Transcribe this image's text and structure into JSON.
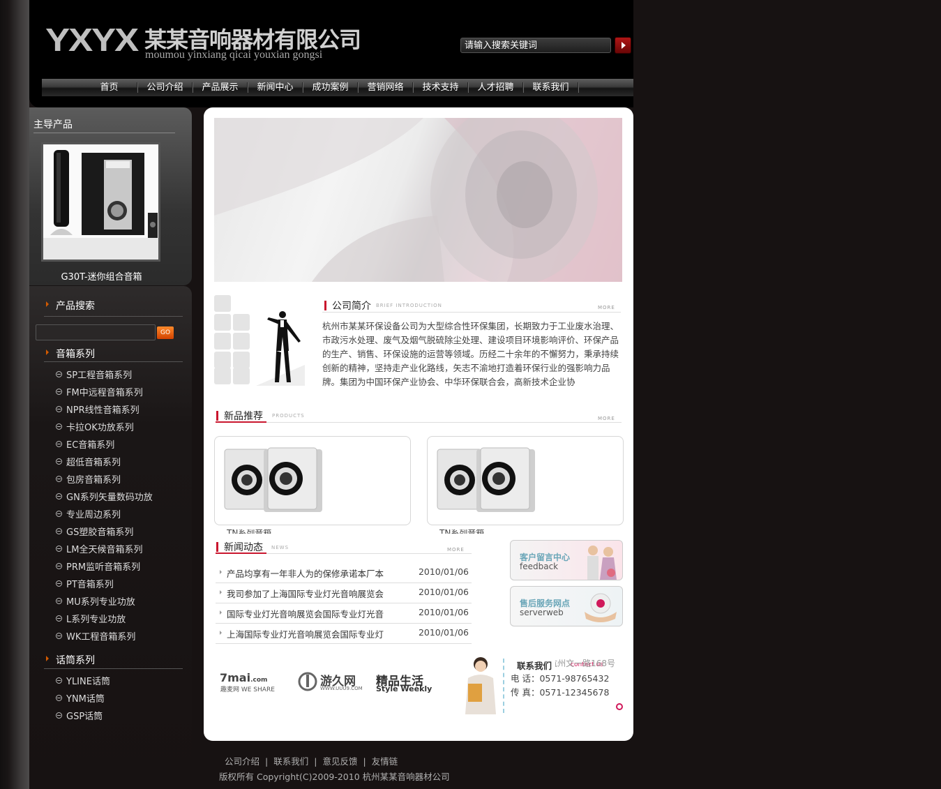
{
  "header": {
    "logo_en": "YXYX",
    "logo_cn": "某某音响器材有限公司",
    "logo_pinyin": "moumou yinxiang qicai youxian gongsi",
    "search_placeholder": "请输入搜索关键词"
  },
  "nav": [
    "首页",
    "公司介绍",
    "产品展示",
    "新闻中心",
    "成功案例",
    "营销网络",
    "技术支持",
    "人才招聘",
    "联系我们"
  ],
  "featured": {
    "title": "主导产品",
    "product_name": "G30T-迷你组合音箱"
  },
  "sidebar": {
    "search_title": "产品搜索",
    "go_label": "GO",
    "speaker_title": "音箱系列",
    "speaker_items": [
      "SP工程音箱系列",
      "FM中远程音箱系列",
      "NPR线性音箱系列",
      "卡拉OK功放系列",
      "EC音箱系列",
      "超低音箱系列",
      "包房音箱系列",
      "GN系列矢量数码功放",
      "专业周边系列",
      "GS塑胶音箱系列",
      "LM全天候音箱系列",
      "PRM监听音箱系列",
      "PT音箱系列",
      "MU系列专业功放",
      "L系列专业功放",
      "WK工程音箱系列"
    ],
    "mic_title": "话筒系列",
    "mic_items": [
      "YLINE话筒",
      "YNM话筒",
      "GSP话筒"
    ]
  },
  "intro": {
    "title": "公司简介",
    "title_en": "BRIEF INTRODUCTION",
    "more": "MORE",
    "text": "杭州市某某环保设备公司为大型综合性环保集团，长期致力于工业废水治理、市政污水处理、废气及烟气脱硫除尘处理、建设项目环境影响评价、环保产品的生产、销售、环保设施的运营等领域。历经二十余年的不懈努力，秉承持续创新的精神，坚持走产业化路线，矢志不渝地打造着环保行业的强影响力品牌。集团为中国环保产业协会、中华环保联合会，高新技术企业协"
  },
  "products": {
    "title": "新品推荐",
    "title_en": "PRODUCTS",
    "more": "MORE",
    "items": [
      {
        "name": "TN系列音箱"
      },
      {
        "name": "TN系列音箱"
      }
    ]
  },
  "news": {
    "title": "新闻动态",
    "title_en": "NEWS",
    "more": "MORE",
    "items": [
      {
        "title": "产品均享有一年非人为的保修承诺本厂本",
        "date": "2010/01/06"
      },
      {
        "title": "我司参加了上海国际专业灯光音响展览会",
        "date": "2010/01/06"
      },
      {
        "title": "国际专业灯光音响展览会国际专业灯光音",
        "date": "2010/01/06"
      },
      {
        "title": "上海国际专业灯光音响展览会国际专业灯",
        "date": "2010/01/06"
      }
    ]
  },
  "side_banners": [
    {
      "cn": "客户留言中心",
      "en": "feedback"
    },
    {
      "cn": "售后服务网点",
      "en": "serverweb"
    }
  ],
  "partners": {
    "p1_main": "7mai",
    "p1_suffix": ".com",
    "p1_sub": "趣麦网 WE SHARE",
    "p2_main": "游久网",
    "p2_sub": "WWW.UUU9.COM",
    "p3_main": "精品生活",
    "p3_sub": "Style Weekly"
  },
  "contact": {
    "title": "联系我们",
    "title_en": "contact us",
    "address": "地址：杭州文一路168号",
    "phone": "电 话：0571-98765432",
    "fax": "传 真：0571-12345678"
  },
  "footer": {
    "links": [
      "公司介绍",
      "联系我们",
      "意见反馈",
      "友情链"
    ],
    "copyright": "版权所有 Copyright(C)2009-2010 杭州某某音响器材公司"
  },
  "colors": {
    "accent_red": "#c9162e",
    "page_bg": "#171212",
    "go_orange": "#f06a10"
  }
}
